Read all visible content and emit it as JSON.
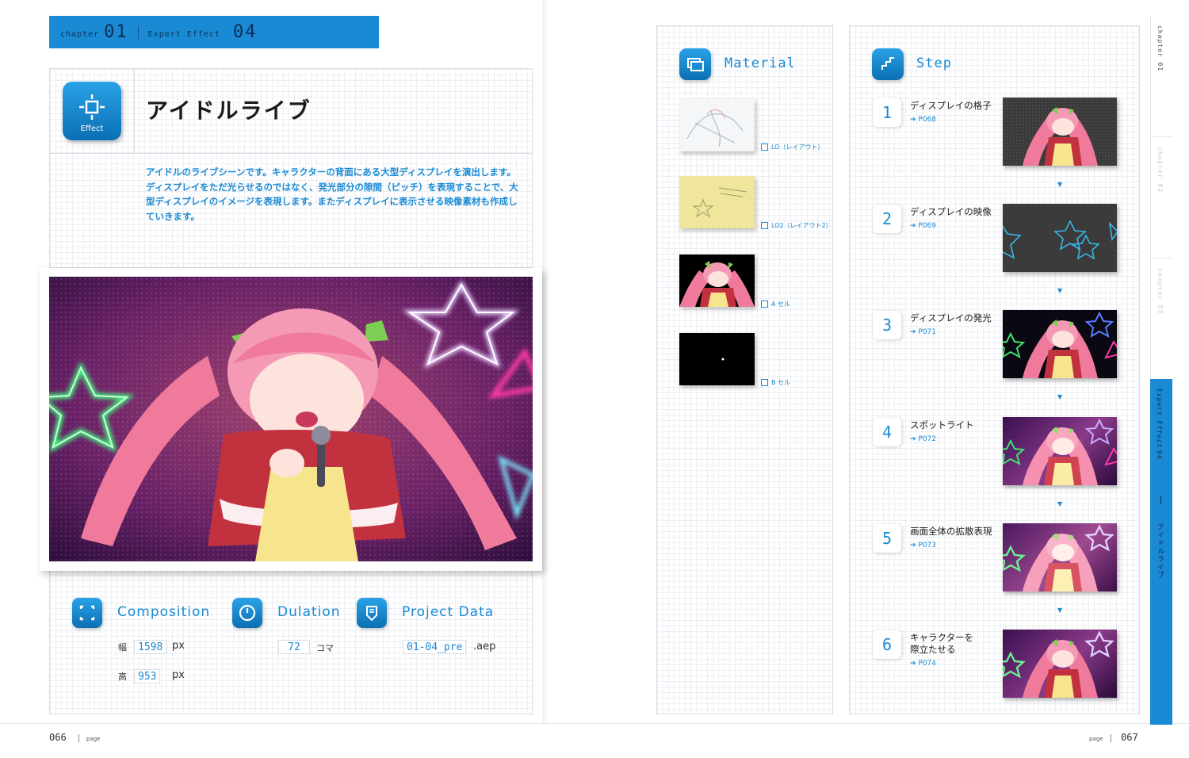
{
  "header": {
    "chapter_word": "chapter",
    "chapter_num": "01",
    "section_word": "Expert Effect",
    "section_num": "04"
  },
  "effect_icon": {
    "label": "Effect",
    "icon": "crosshair-icon"
  },
  "title": "アイドルライブ",
  "intro": "アイドルのライブシーンです。キャラクターの背面にある大型ディスプレイを演出します。ディスプレイをただ光らせるのではなく、発光部分の隙間（ピッチ）を表現することで、大型ディスプレイのイメージを表現します。またディスプレイに表示させる映像素材も作成していきます。",
  "info": {
    "composition": {
      "title": "Composition",
      "width_label": "幅",
      "width_value": "1598",
      "height_label": "高",
      "height_value": "953",
      "unit": "px"
    },
    "duration": {
      "title": "Dulation",
      "value": "72",
      "unit": "コマ"
    },
    "project": {
      "title": "Project Data",
      "file": "01-04_pre",
      "ext": ".aep"
    }
  },
  "footer_left": {
    "page_num": "066",
    "page_word": "page"
  },
  "footer_right": {
    "page_num": "067",
    "page_word": "page"
  },
  "material": {
    "title": "Material",
    "items": [
      {
        "label": "LO（レイアウト）",
        "kind": "sketch"
      },
      {
        "label": "LO2（レイアウト2）",
        "kind": "yellow"
      },
      {
        "label": "A セル",
        "kind": "character"
      },
      {
        "label": "B セル",
        "kind": "black"
      }
    ]
  },
  "step": {
    "title": "Step",
    "items": [
      {
        "num": "1",
        "title": "ディスプレイの格子",
        "ref": "P068"
      },
      {
        "num": "2",
        "title": "ディスプレイの映像",
        "ref": "P069"
      },
      {
        "num": "3",
        "title": "ディスプレイの発光",
        "ref": "P071"
      },
      {
        "num": "4",
        "title": "スポットライト",
        "ref": "P072"
      },
      {
        "num": "5",
        "title": "画面全体の拡散表現",
        "ref": "P073"
      },
      {
        "num": "6",
        "title": "キャラクターを\n際立たせる",
        "ref": "P074"
      }
    ]
  },
  "side_tabs": {
    "tab1": "chapter 01",
    "tab2": "chapter 02",
    "tab3": "chapter 03",
    "active_section": "Expert Effect",
    "active_num": "04",
    "active_title": "アイドルライブ"
  },
  "colors": {
    "accent": "#1a8ad4",
    "dark": "#0b2f55"
  }
}
